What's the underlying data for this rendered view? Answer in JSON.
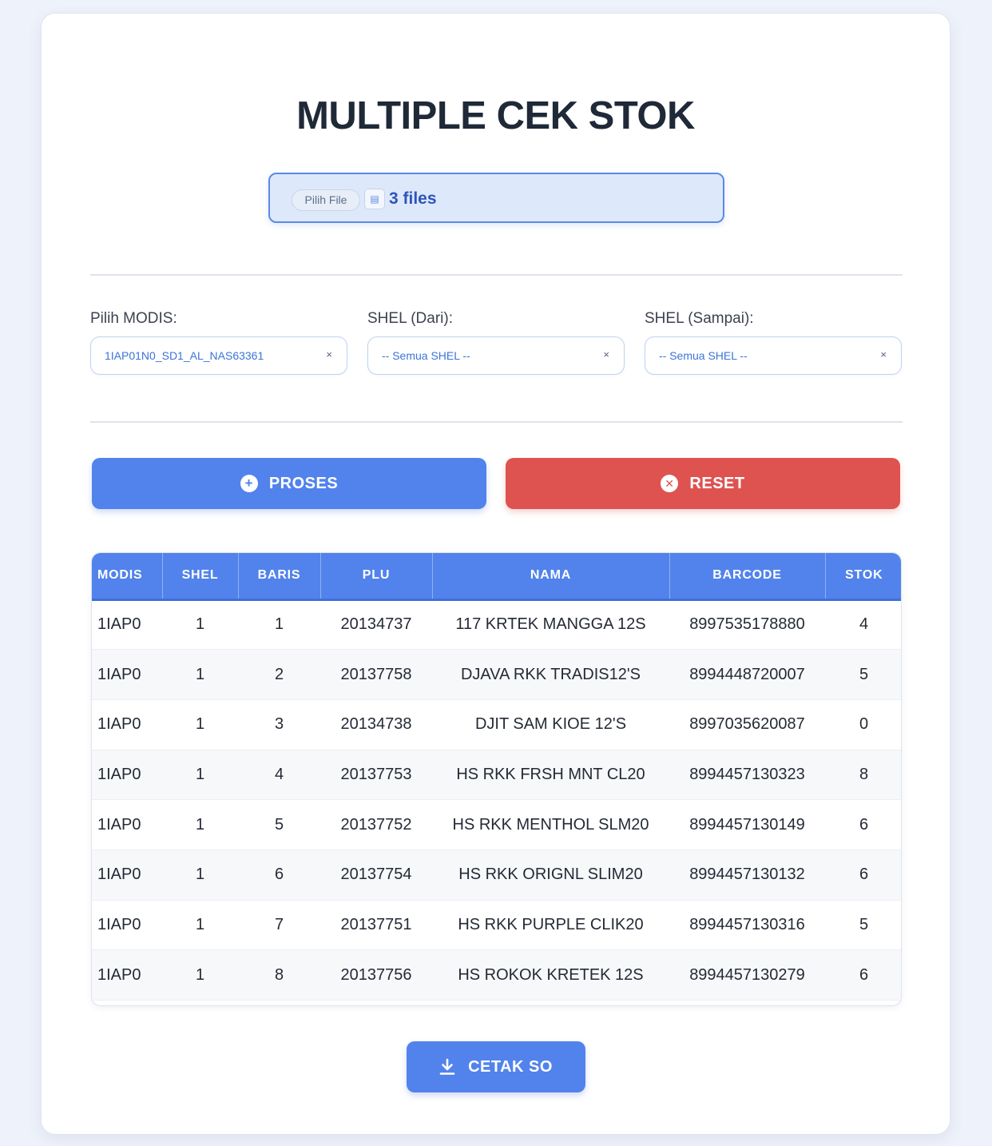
{
  "title": "MULTIPLE CEK STOK",
  "file_input": {
    "button_label": "Pilih File",
    "file_count": "3 files"
  },
  "filters": {
    "modis": {
      "label": "Pilih MODIS:",
      "value": "1IAP01N0_SD1_AL_NAS63361",
      "clear": "×"
    },
    "shel_dari": {
      "label": "SHEL (Dari):",
      "value": "-- Semua SHEL --",
      "clear": "×"
    },
    "shel_sampai": {
      "label": "SHEL (Sampai):",
      "value": "-- Semua SHEL --",
      "clear": "×"
    }
  },
  "actions": {
    "proses": "PROSES",
    "reset": "RESET",
    "cetak": "CETAK SO"
  },
  "table": {
    "columns": [
      "MODIS",
      "SHEL",
      "BARIS",
      "PLU",
      "NAMA",
      "BARCODE",
      "STOK"
    ],
    "rows": [
      [
        "1IAP0",
        "1",
        "1",
        "20134737",
        "117 KRTEK MANGGA 12S",
        "8997535178880",
        "4"
      ],
      [
        "1IAP0",
        "1",
        "2",
        "20137758",
        "DJAVA RKK TRADIS12'S",
        "8994448720007",
        "5"
      ],
      [
        "1IAP0",
        "1",
        "3",
        "20134738",
        "DJIT SAM KIOE 12'S",
        "8997035620087",
        "0"
      ],
      [
        "1IAP0",
        "1",
        "4",
        "20137753",
        "HS RKK FRSH MNT CL20",
        "8994457130323",
        "8"
      ],
      [
        "1IAP0",
        "1",
        "5",
        "20137752",
        "HS RKK MENTHOL SLM20",
        "8994457130149",
        "6"
      ],
      [
        "1IAP0",
        "1",
        "6",
        "20137754",
        "HS RKK ORIGNL SLIM20",
        "8994457130132",
        "6"
      ],
      [
        "1IAP0",
        "1",
        "7",
        "20137751",
        "HS RKK PURPLE CLIK20",
        "8994457130316",
        "5"
      ],
      [
        "1IAP0",
        "1",
        "8",
        "20137756",
        "HS ROKOK KRETEK 12S",
        "8994457130279",
        "6"
      ]
    ]
  },
  "colors": {
    "primary": "#5283ec",
    "danger": "#de5350",
    "background": "#eef2fa"
  }
}
